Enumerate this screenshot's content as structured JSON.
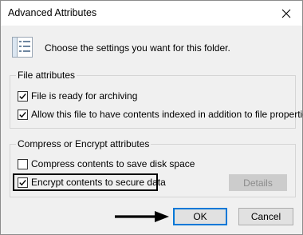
{
  "window": {
    "title": "Advanced Attributes"
  },
  "header": {
    "text": "Choose the settings you want for this folder."
  },
  "file_attributes": {
    "title": "File attributes",
    "options": [
      {
        "label": "File is ready for archiving",
        "checked": true
      },
      {
        "label": "Allow this file to have contents indexed in addition to file properties",
        "checked": true
      }
    ]
  },
  "compress_encrypt": {
    "title": "Compress or Encrypt attributes",
    "options": [
      {
        "label": "Compress contents to save disk space",
        "checked": false
      },
      {
        "label": "Encrypt contents to secure data",
        "checked": true
      }
    ],
    "details_label": "Details"
  },
  "buttons": {
    "ok": "OK",
    "cancel": "Cancel"
  },
  "icons": {
    "close": "close-icon",
    "folder_settings": "properties-list-icon",
    "arrow": "arrow-right-icon"
  },
  "colors": {
    "accent": "#0078d7",
    "disabled_bg": "#cccccc",
    "disabled_text": "#8c8c8c"
  }
}
